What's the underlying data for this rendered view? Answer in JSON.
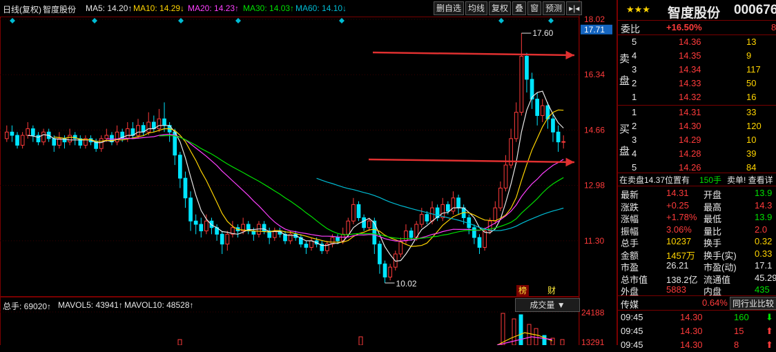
{
  "indicator_bar": {
    "period": "日线(复权)",
    "stock": "智度股份",
    "ma5": "MA5: 14.20↑",
    "ma10": "MA10: 14.29↓",
    "ma20": "MA20: 14.23↑",
    "ma30": "MA30: 14.03↑",
    "ma60": "MA60: 14.10↓"
  },
  "toolbar": [
    "删自选",
    "均线",
    "复权",
    "叠",
    "窗",
    "预测",
    "▸|◂"
  ],
  "price_axis": {
    "labels": [
      "18.02",
      "17.71",
      "16.34",
      "14.66",
      "12.98",
      "11.30"
    ],
    "current_price_tag": "17.71"
  },
  "annotations": {
    "high": "17.60",
    "low": "10.02"
  },
  "markers": {
    "bang": "榜",
    "cai": "财"
  },
  "volume_bar": {
    "total": "总手: 69020↑",
    "mavol5": "MAVOL5: 43941↑",
    "mavol10": "MAVOL10: 48528↑",
    "dropdown": "成交量 ▼",
    "axis_top": "24188",
    "axis_2": "13291"
  },
  "panel": {
    "stars": "★★★",
    "name": "智度股份",
    "code": "000676",
    "weibi_label": "委比",
    "weibi_value": "+16.50%",
    "weibi_extra": "8",
    "sell_label": [
      "卖",
      "盘"
    ],
    "buy_label": [
      "买",
      "盘"
    ],
    "sell": [
      {
        "level": "5",
        "price": "14.36",
        "vol": "13"
      },
      {
        "level": "4",
        "price": "14.35",
        "vol": "9"
      },
      {
        "level": "3",
        "price": "14.34",
        "vol": "117"
      },
      {
        "level": "2",
        "price": "14.33",
        "vol": "50"
      },
      {
        "level": "1",
        "price": "14.32",
        "vol": "16"
      }
    ],
    "buy": [
      {
        "level": "1",
        "price": "14.31",
        "vol": "33"
      },
      {
        "level": "2",
        "price": "14.30",
        "vol": "120"
      },
      {
        "level": "3",
        "price": "14.29",
        "vol": "10"
      },
      {
        "level": "4",
        "price": "14.28",
        "vol": "39"
      },
      {
        "level": "5",
        "price": "14.26",
        "vol": "84"
      }
    ],
    "notice_a": "在卖盘14.37位置有",
    "notice_b": "150手",
    "notice_c": "卖单! 查看详",
    "stats": [
      {
        "k1": "最新",
        "v1": "14.31",
        "k2": "开盘",
        "v2": "13.9"
      },
      {
        "k1": "涨跌",
        "v1": "+0.25",
        "k2": "最高",
        "v2": "14.3"
      },
      {
        "k1": "涨幅",
        "v1": "+1.78%",
        "k2": "最低",
        "v2": "13.9"
      },
      {
        "k1": "振幅",
        "v1": "3.06%",
        "k2": "量比",
        "v2": "2.0"
      },
      {
        "k1": "总手",
        "v1": "10237",
        "k2": "换手",
        "v2": "0.32"
      },
      {
        "k1": "金额",
        "v1": "1457万",
        "k2": "换手(实)",
        "v2": "0.33"
      },
      {
        "k1": "市盈",
        "v1": "26.21",
        "k2": "市盈(动)",
        "v2": "17.1"
      },
      {
        "k1": "总市值",
        "v1": "138.2亿",
        "k2": "流通值",
        "v2": "45.29"
      },
      {
        "k1": "外盘",
        "v1": "5883",
        "k2": "内盘",
        "v2": "435"
      }
    ],
    "media_label": "传媒",
    "media_pct": "0.64%",
    "compare_btn": "同行业比较",
    "ticks": [
      {
        "time": "09:45",
        "price": "14.30",
        "vol": "160",
        "dir": "down"
      },
      {
        "time": "09:45",
        "price": "14.30",
        "vol": "15",
        "dir": "up"
      },
      {
        "time": "09:45",
        "price": "14.30",
        "vol": "8",
        "dir": "up"
      }
    ]
  },
  "colors": {
    "up": "#ff3b3b",
    "down": "#00e5ff",
    "ma5": "#e8e8e8",
    "ma10": "#ffd400",
    "ma20": "#ff40ff",
    "ma30": "#00e000",
    "ma60": "#00bcd4",
    "arrow": "#e03030"
  },
  "chart_data": {
    "type": "candlestick",
    "y_range": [
      10.02,
      18.02
    ],
    "candles": [
      [
        14.4,
        14.6,
        14.8,
        14.3
      ],
      [
        14.6,
        14.5,
        14.8,
        14.3
      ],
      [
        14.5,
        14.2,
        14.6,
        14.1
      ],
      [
        14.2,
        14.5,
        14.6,
        14.1
      ],
      [
        14.5,
        14.7,
        14.9,
        14.4
      ],
      [
        14.7,
        14.5,
        14.8,
        14.3
      ],
      [
        14.5,
        14.3,
        14.6,
        14.2
      ],
      [
        14.3,
        14.6,
        14.7,
        14.2
      ],
      [
        14.6,
        14.4,
        14.7,
        14.3
      ],
      [
        14.4,
        14.2,
        14.5,
        14.0
      ],
      [
        14.2,
        14.4,
        14.6,
        14.1
      ],
      [
        14.4,
        14.3,
        14.5,
        14.1
      ],
      [
        14.3,
        14.5,
        14.7,
        14.2
      ],
      [
        14.5,
        14.4,
        14.6,
        14.2
      ],
      [
        14.4,
        14.2,
        14.5,
        14.1
      ],
      [
        14.2,
        14.4,
        14.5,
        14.1
      ],
      [
        14.4,
        14.3,
        14.5,
        14.2
      ],
      [
        14.3,
        14.1,
        14.4,
        14.0
      ],
      [
        14.1,
        14.4,
        14.5,
        14.0
      ],
      [
        14.4,
        14.5,
        14.7,
        14.3
      ],
      [
        14.5,
        14.3,
        14.6,
        14.2
      ],
      [
        14.3,
        14.6,
        14.8,
        14.2
      ],
      [
        14.6,
        14.4,
        14.7,
        14.3
      ],
      [
        14.4,
        14.7,
        14.9,
        14.3
      ],
      [
        14.7,
        14.5,
        14.9,
        14.4
      ],
      [
        14.5,
        14.8,
        15.0,
        14.4
      ],
      [
        14.8,
        14.6,
        14.9,
        14.5
      ],
      [
        14.6,
        14.9,
        15.2,
        14.5
      ],
      [
        14.9,
        14.7,
        15.1,
        14.6
      ],
      [
        14.7,
        15.0,
        15.3,
        14.6
      ],
      [
        15.0,
        14.8,
        15.5,
        14.6
      ],
      [
        14.8,
        14.6,
        14.9,
        14.3
      ],
      [
        14.6,
        13.9,
        14.7,
        13.6
      ],
      [
        13.9,
        13.2,
        14.0,
        12.9
      ],
      [
        13.2,
        12.6,
        13.4,
        12.3
      ],
      [
        12.6,
        11.9,
        12.8,
        11.6
      ],
      [
        11.9,
        11.8,
        12.1,
        11.5
      ],
      [
        11.8,
        11.6,
        12.0,
        11.4
      ],
      [
        11.6,
        11.9,
        12.1,
        11.5
      ],
      [
        11.9,
        11.7,
        12.0,
        11.5
      ],
      [
        11.7,
        11.5,
        11.8,
        11.3
      ],
      [
        11.5,
        11.2,
        11.6,
        10.9
      ],
      [
        11.2,
        11.5,
        11.6,
        11.0
      ],
      [
        11.5,
        11.7,
        11.9,
        11.4
      ],
      [
        11.7,
        11.6,
        11.8,
        11.4
      ],
      [
        11.6,
        11.8,
        12.0,
        11.5
      ],
      [
        11.8,
        11.6,
        11.9,
        11.5
      ],
      [
        11.6,
        11.5,
        11.7,
        11.3
      ],
      [
        11.5,
        11.8,
        11.9,
        11.4
      ],
      [
        11.8,
        11.6,
        11.9,
        11.5
      ],
      [
        11.6,
        11.4,
        11.7,
        11.2
      ],
      [
        11.4,
        11.6,
        11.7,
        11.3
      ],
      [
        11.6,
        11.5,
        11.7,
        11.4
      ],
      [
        11.5,
        11.3,
        11.6,
        11.2
      ],
      [
        11.3,
        11.5,
        11.6,
        11.2
      ],
      [
        11.5,
        11.4,
        11.6,
        11.3
      ],
      [
        11.4,
        11.2,
        11.5,
        11.1
      ],
      [
        11.2,
        11.1,
        11.3,
        10.9
      ],
      [
        11.1,
        11.3,
        11.4,
        11.0
      ],
      [
        11.3,
        11.2,
        11.4,
        11.1
      ],
      [
        11.2,
        11.0,
        11.3,
        10.9
      ],
      [
        11.0,
        11.2,
        11.3,
        10.9
      ],
      [
        11.2,
        11.4,
        11.5,
        11.1
      ],
      [
        11.4,
        11.3,
        11.5,
        11.2
      ],
      [
        11.3,
        11.5,
        11.7,
        11.2
      ],
      [
        11.5,
        11.9,
        12.0,
        11.4
      ],
      [
        11.9,
        12.4,
        12.6,
        11.8
      ],
      [
        12.4,
        12.0,
        12.5,
        11.9
      ],
      [
        12.0,
        11.7,
        12.1,
        11.6
      ],
      [
        11.7,
        11.9,
        12.0,
        11.6
      ],
      [
        11.9,
        11.2,
        12.0,
        10.9
      ],
      [
        11.2,
        10.6,
        11.3,
        10.3
      ],
      [
        10.6,
        10.2,
        10.7,
        10.02
      ],
      [
        10.2,
        10.5,
        10.6,
        10.1
      ],
      [
        10.5,
        10.9,
        11.0,
        10.4
      ],
      [
        10.9,
        11.3,
        11.4,
        10.8
      ],
      [
        11.3,
        11.6,
        11.8,
        11.2
      ],
      [
        11.6,
        11.4,
        11.7,
        11.3
      ],
      [
        11.4,
        11.8,
        11.9,
        11.3
      ],
      [
        11.8,
        12.1,
        12.3,
        11.7
      ],
      [
        12.1,
        11.9,
        12.2,
        11.8
      ],
      [
        11.9,
        12.3,
        12.5,
        11.8
      ],
      [
        12.3,
        12.0,
        12.4,
        11.9
      ],
      [
        12.0,
        12.4,
        12.6,
        11.9
      ],
      [
        12.4,
        12.2,
        12.5,
        12.1
      ],
      [
        12.2,
        12.6,
        12.8,
        12.1
      ],
      [
        12.6,
        12.3,
        12.7,
        12.1
      ],
      [
        12.3,
        12.0,
        12.4,
        11.8
      ],
      [
        12.0,
        11.7,
        12.1,
        11.5
      ],
      [
        11.7,
        11.4,
        11.8,
        11.2
      ],
      [
        11.4,
        11.1,
        11.5,
        10.9
      ],
      [
        11.1,
        11.6,
        11.7,
        11.0
      ],
      [
        11.6,
        11.9,
        12.0,
        11.5
      ],
      [
        11.9,
        12.3,
        12.5,
        11.8
      ],
      [
        12.3,
        12.9,
        13.1,
        12.2
      ],
      [
        12.9,
        13.6,
        13.9,
        12.8
      ],
      [
        13.6,
        14.4,
        14.7,
        13.5
      ],
      [
        14.4,
        15.2,
        15.5,
        14.3
      ],
      [
        15.2,
        16.9,
        17.6,
        15.1
      ],
      [
        16.9,
        16.2,
        17.0,
        15.8
      ],
      [
        16.2,
        15.6,
        16.4,
        15.3
      ],
      [
        15.6,
        15.1,
        15.8,
        14.8
      ],
      [
        15.1,
        15.4,
        15.6,
        14.9
      ],
      [
        15.4,
        15.0,
        15.5,
        14.7
      ],
      [
        15.0,
        14.6,
        15.2,
        14.3
      ],
      [
        14.6,
        14.3,
        14.8,
        14.0
      ],
      [
        14.3,
        14.31,
        14.5,
        14.1
      ]
    ],
    "volume_axis": [
      13291,
      24188
    ]
  }
}
